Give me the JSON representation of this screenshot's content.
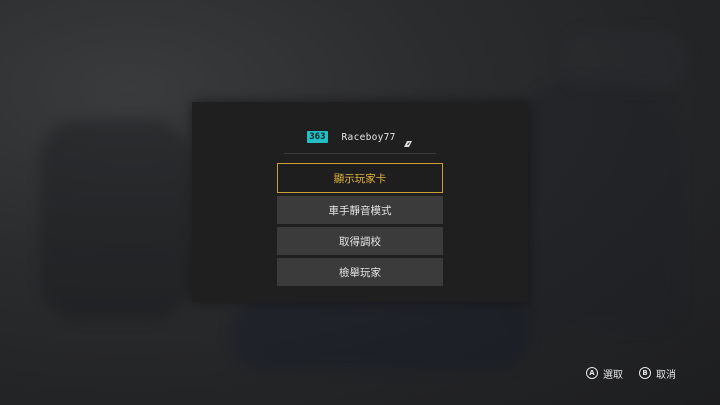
{
  "player": {
    "level": "363",
    "name": "Raceboy77",
    "tag_icon": "platform-tag-icon"
  },
  "menu": {
    "items": [
      {
        "label": "顯示玩家卡",
        "selected": true
      },
      {
        "label": "車手靜音模式",
        "selected": false
      },
      {
        "label": "取得調校",
        "selected": false
      },
      {
        "label": "檢舉玩家",
        "selected": false
      }
    ]
  },
  "footer": {
    "select": {
      "button": "A",
      "label": "選取"
    },
    "cancel": {
      "button": "B",
      "label": "取消"
    }
  },
  "colors": {
    "accent": "#c9a135",
    "level_badge": "#23bfc4",
    "panel": "#1f1f1f",
    "menu_item": "#3b3b3b"
  }
}
